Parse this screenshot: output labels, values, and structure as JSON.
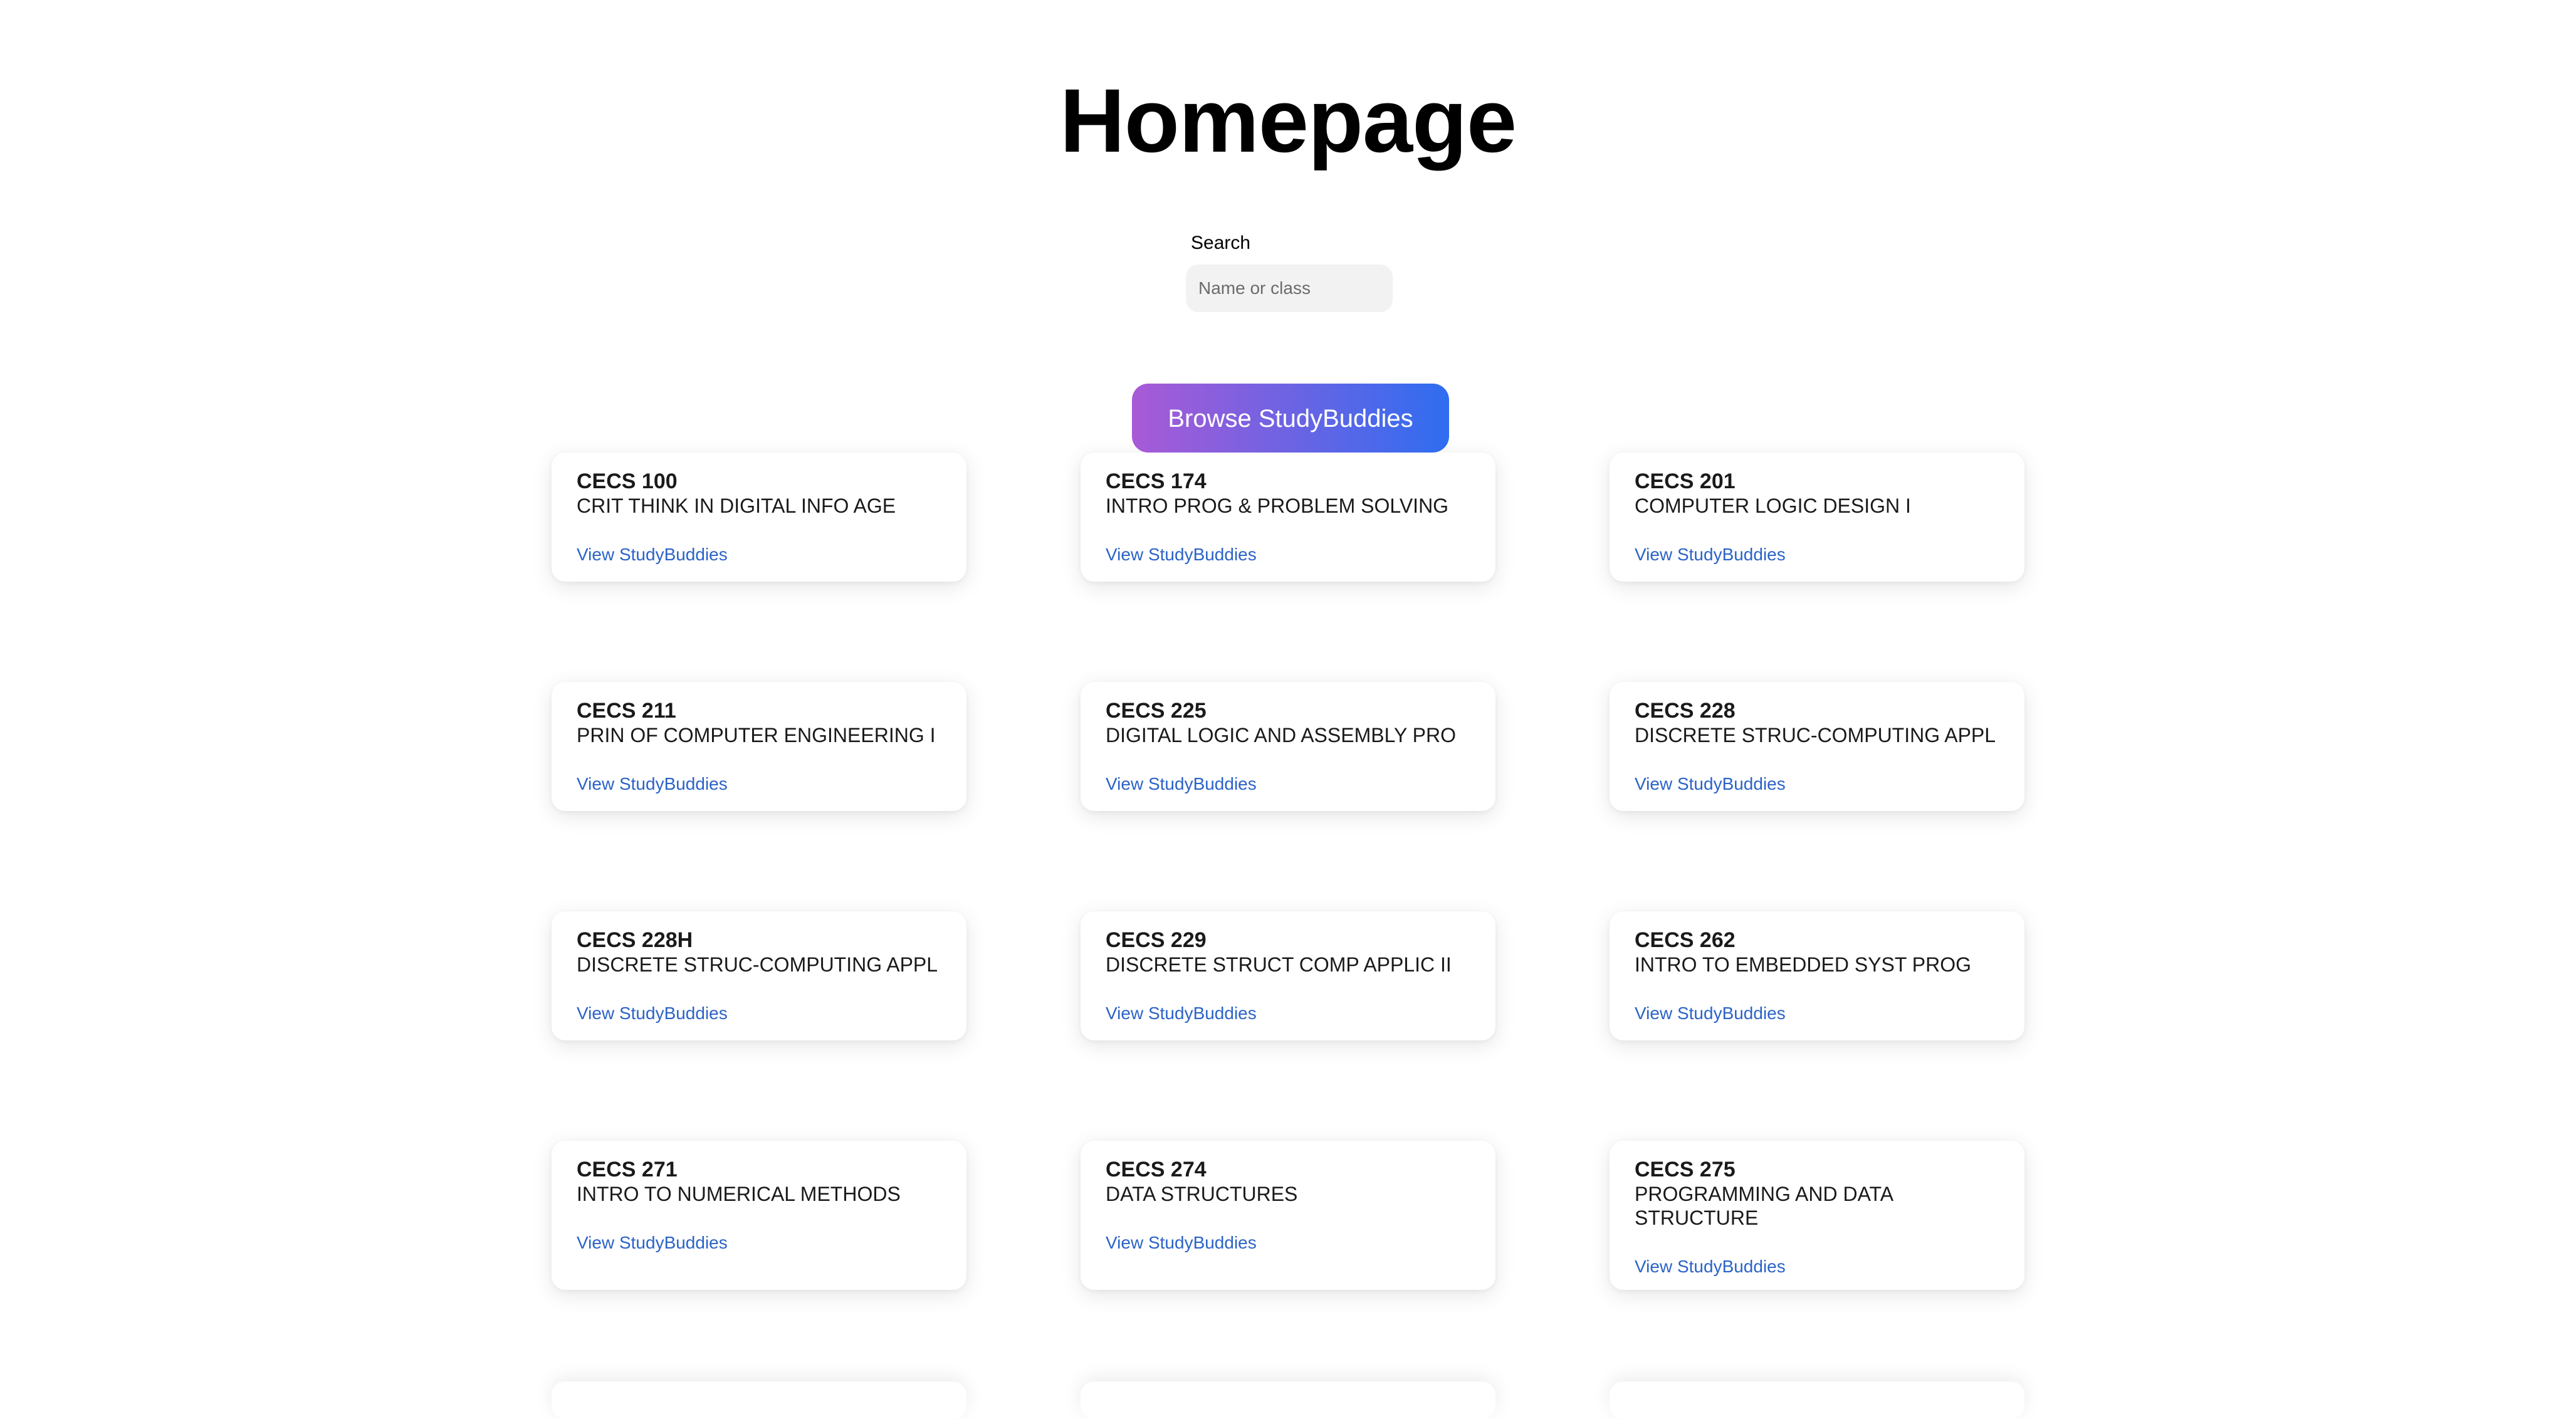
{
  "page": {
    "title": "Homepage"
  },
  "search": {
    "label": "Search",
    "placeholder": "Name or class",
    "value": ""
  },
  "browse_button": {
    "label": "Browse StudyBuddies",
    "gradient_start": "#a95ad6",
    "gradient_end": "#2f6df0"
  },
  "theme": {
    "link_color": "#2b63c8",
    "card_background": "#ffffff",
    "input_background": "#f2f2f3"
  },
  "courses": [
    {
      "code": "CECS 100",
      "name": "CRIT THINK IN DIGITAL INFO AGE",
      "link": "View StudyBuddies"
    },
    {
      "code": "CECS 174",
      "name": "INTRO PROG & PROBLEM SOLVING",
      "link": "View StudyBuddies"
    },
    {
      "code": "CECS 201",
      "name": "COMPUTER LOGIC DESIGN I",
      "link": "View StudyBuddies"
    },
    {
      "code": "CECS 211",
      "name": "PRIN OF COMPUTER ENGINEERING I",
      "link": "View StudyBuddies"
    },
    {
      "code": "CECS 225",
      "name": "DIGITAL LOGIC AND ASSEMBLY PRO",
      "link": "View StudyBuddies"
    },
    {
      "code": "CECS 228",
      "name": "DISCRETE STRUC-COMPUTING APPL",
      "link": "View StudyBuddies"
    },
    {
      "code": "CECS 228H",
      "name": "DISCRETE STRUC-COMPUTING APPL",
      "link": "View StudyBuddies"
    },
    {
      "code": "CECS 229",
      "name": "DISCRETE STRUCT COMP APPLIC II",
      "link": "View StudyBuddies"
    },
    {
      "code": "CECS 262",
      "name": "INTRO TO EMBEDDED SYST PROG",
      "link": "View StudyBuddies"
    },
    {
      "code": "CECS 271",
      "name": "INTRO TO NUMERICAL METHODS",
      "link": "View StudyBuddies"
    },
    {
      "code": "CECS 274",
      "name": "DATA STRUCTURES",
      "link": "View StudyBuddies"
    },
    {
      "code": "CECS 275",
      "name": "PROGRAMMING AND DATA STRUCTURE",
      "link": "View StudyBuddies"
    }
  ]
}
